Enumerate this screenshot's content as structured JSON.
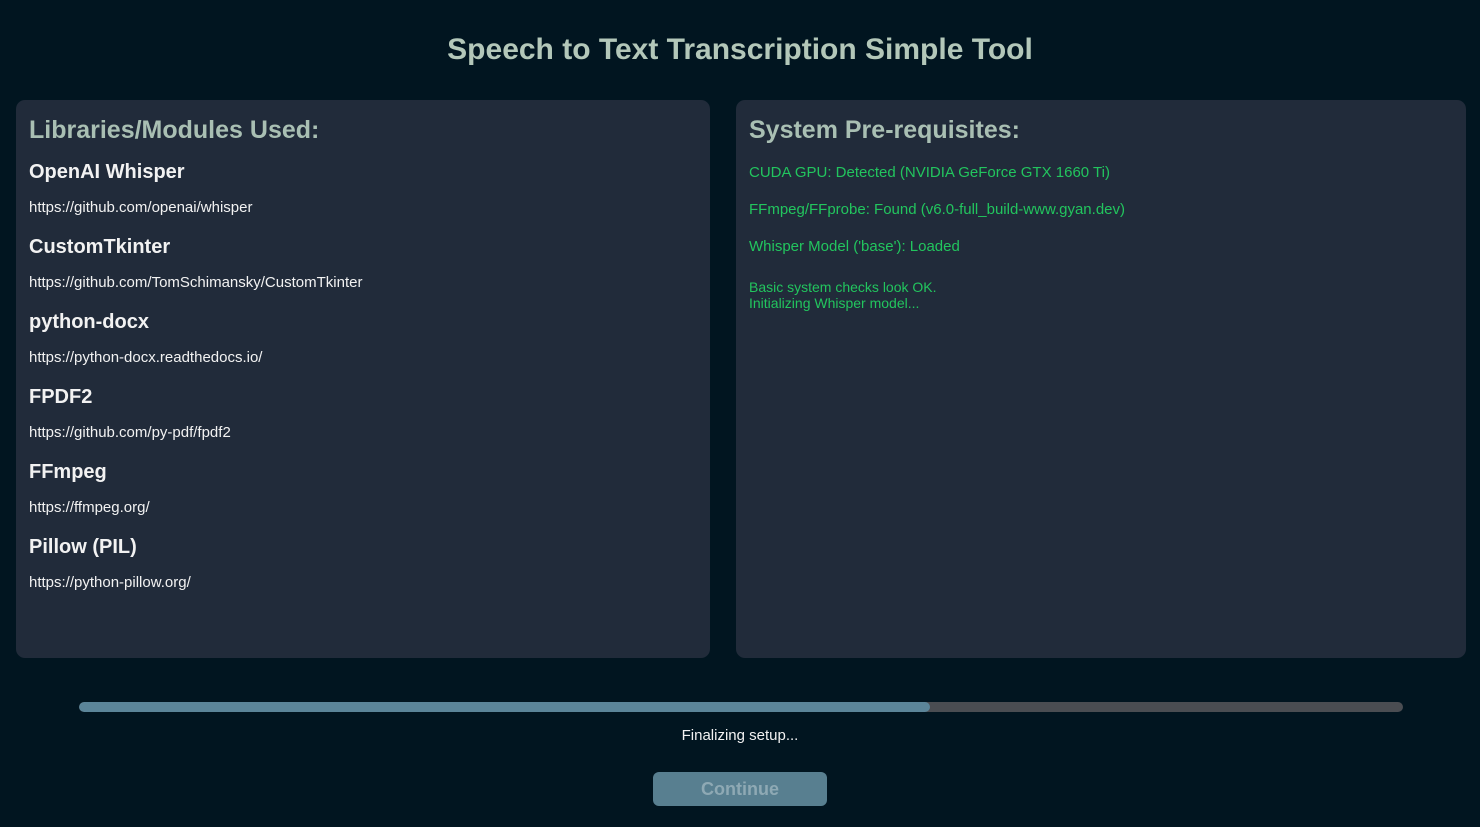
{
  "app": {
    "title": "Speech to Text Transcription Simple Tool"
  },
  "libraries": {
    "heading": "Libraries/Modules Used:",
    "items": [
      {
        "name": "OpenAI Whisper",
        "url": "https://github.com/openai/whisper"
      },
      {
        "name": "CustomTkinter",
        "url": "https://github.com/TomSchimansky/CustomTkinter"
      },
      {
        "name": "python-docx",
        "url": "https://python-docx.readthedocs.io/"
      },
      {
        "name": "FPDF2",
        "url": "https://github.com/py-pdf/fpdf2"
      },
      {
        "name": "FFmpeg",
        "url": "https://ffmpeg.org/"
      },
      {
        "name": "Pillow (PIL)",
        "url": "https://python-pillow.org/"
      }
    ]
  },
  "prerequisites": {
    "heading": "System Pre-requisites:",
    "checks": [
      "CUDA GPU: Detected (NVIDIA GeForce GTX 1660 Ti)",
      "FFmpeg/FFprobe: Found (v6.0-full_build-www.gyan.dev)",
      "Whisper Model ('base'): Loaded"
    ],
    "log": [
      "Basic system checks look OK.",
      "Initializing Whisper model..."
    ],
    "status_color": "#22c55e"
  },
  "progress": {
    "value": 0.643,
    "status_text": "Finalizing setup..."
  },
  "continue_button": {
    "label": "Continue",
    "enabled": false
  }
}
